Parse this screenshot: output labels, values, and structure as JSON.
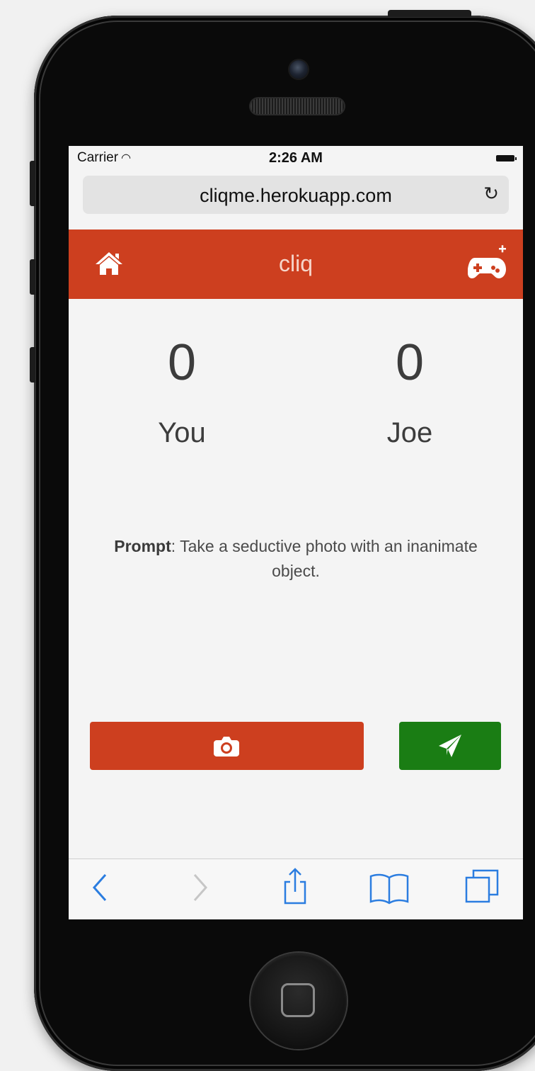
{
  "status_bar": {
    "carrier": "Carrier",
    "time": "2:26 AM"
  },
  "browser": {
    "url": "cliqme.herokuapp.com"
  },
  "app": {
    "title": "cliq",
    "accent_color": "#cd3f1f",
    "send_color": "#1a7d14"
  },
  "scores": {
    "player": {
      "value": "0",
      "name": "You"
    },
    "opponent": {
      "value": "0",
      "name": "Joe"
    }
  },
  "prompt": {
    "label": "Prompt",
    "separator": ":",
    "text": " Take a seductive photo with an inanimate object."
  },
  "icons": {
    "nav_left": "home-icon",
    "nav_right": "gamepad-plus-icon",
    "camera_button": "camera-icon",
    "send_button": "paper-plane-icon",
    "toolbar": [
      "back-icon",
      "forward-icon",
      "share-icon",
      "bookmarks-icon",
      "tabs-icon"
    ]
  }
}
